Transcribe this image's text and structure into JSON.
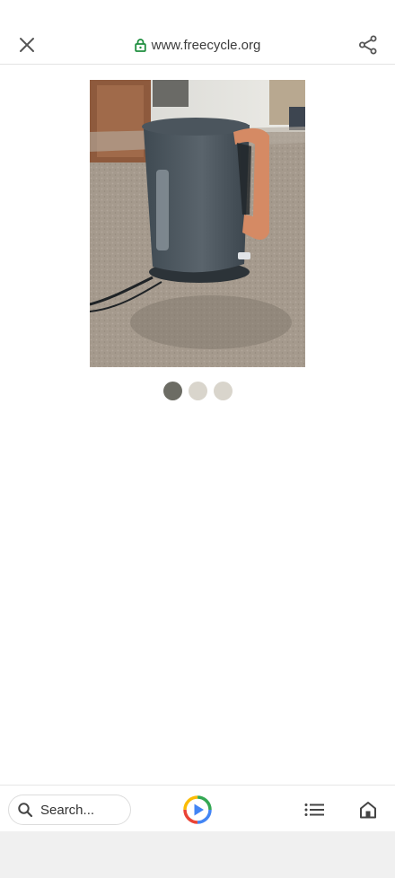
{
  "browser": {
    "url": "www.freecycle.org",
    "icons": {
      "close": "close-icon",
      "lock": "lock-icon",
      "share": "share-icon"
    },
    "lock_color": "#1e8e3e"
  },
  "gallery": {
    "image_subject": "kettle",
    "total_images": 3,
    "active_index": 0
  },
  "bottom_bar": {
    "search_placeholder": "Search...",
    "icons": {
      "search": "search-icon",
      "assistant": "assistant-play-icon",
      "list": "list-icon",
      "home": "home-icon"
    }
  }
}
